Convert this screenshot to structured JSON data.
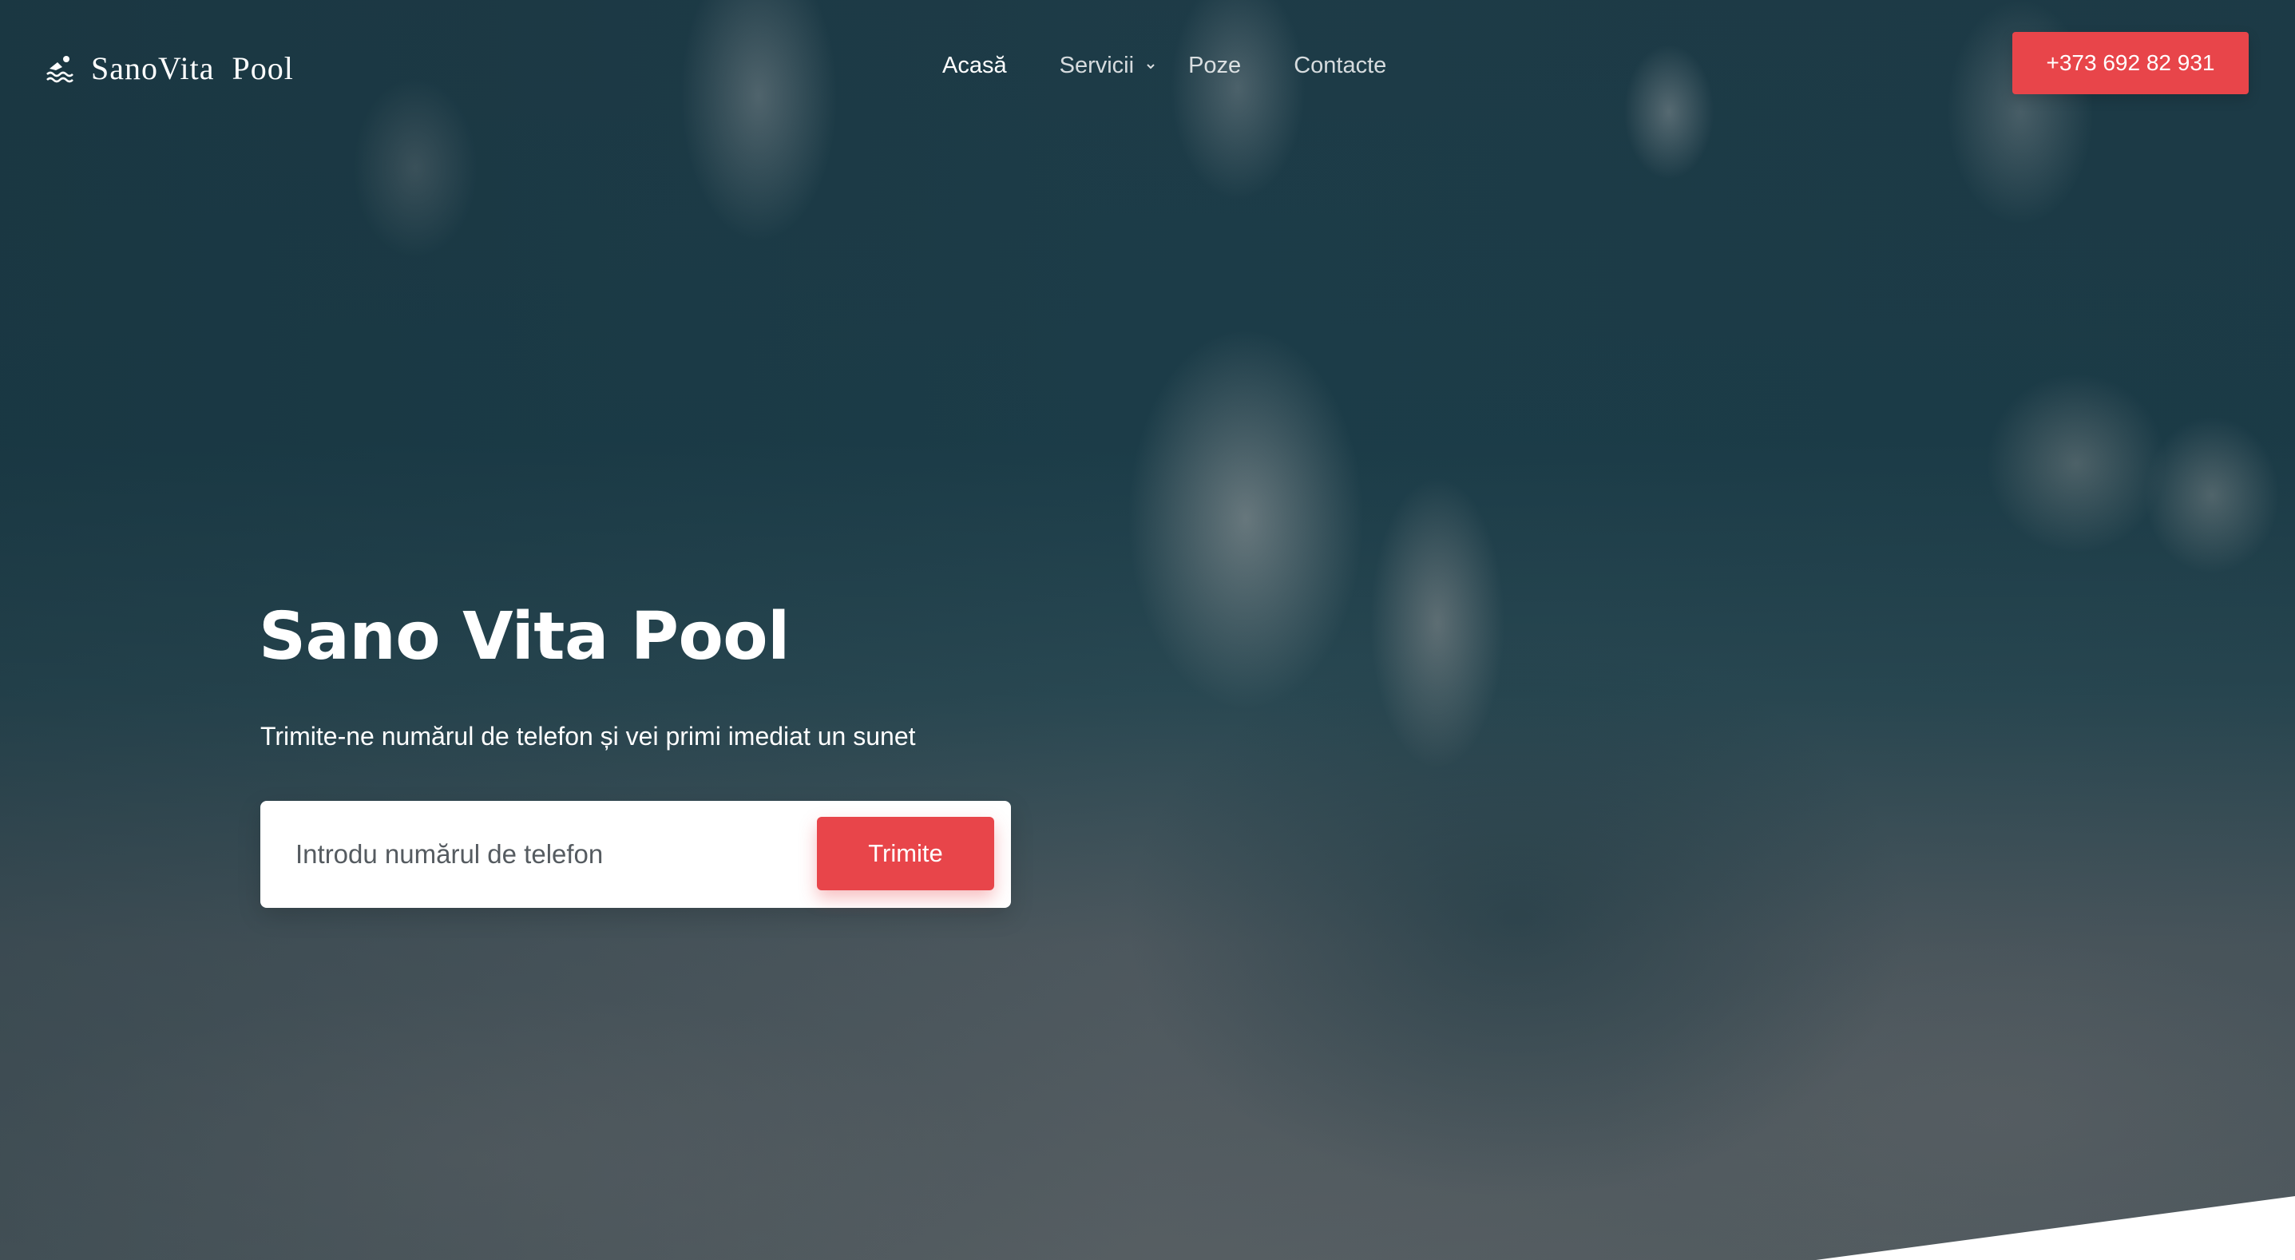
{
  "header": {
    "logo": {
      "icon": "swimmer-icon",
      "text": "SanoVita  Pool"
    },
    "nav": [
      {
        "label": "Acasă",
        "active": true
      },
      {
        "label": "Servicii",
        "has_dropdown": true
      },
      {
        "label": "Poze"
      },
      {
        "label": "Contacte"
      }
    ],
    "phone_button": "+373 692 82 931"
  },
  "hero": {
    "title": "Sano Vita Pool",
    "subtitle": "Trimite-ne numărul de telefon și vei primi imediat un sunet",
    "form": {
      "input_placeholder": "Introdu numărul de telefon",
      "input_value": "",
      "submit_label": "Trimite"
    }
  },
  "colors": {
    "accent": "#e8454a",
    "text_light": "#ffffff",
    "overlay": "#1c3d49"
  }
}
